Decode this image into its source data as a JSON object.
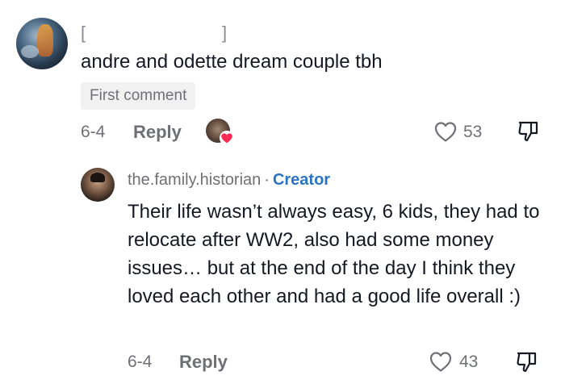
{
  "comment": {
    "username_open": "[",
    "username_close": "]",
    "text": "andre and odette dream couple tbh",
    "badge": "First comment",
    "date": "6-4",
    "reply_label": "Reply",
    "like_count": "53"
  },
  "reply": {
    "username": "the.family.historian",
    "separator": "·",
    "role": "Creator",
    "text": "Their life wasn’t always easy, 6 kids, they had to relocate after WW2, also had some money issues… but at the end of the day I think they loved each other and had a good life overall :)",
    "date": "6-4",
    "reply_label": "Reply",
    "like_count": "43"
  },
  "icons": {
    "like": "heart-outline-icon",
    "dislike": "thumbs-down-icon",
    "creator_liked": "heart-filled-icon"
  },
  "colors": {
    "creator": "#2b74c3",
    "liked_heart": "#fe2c55",
    "muted": "#6f7076"
  }
}
